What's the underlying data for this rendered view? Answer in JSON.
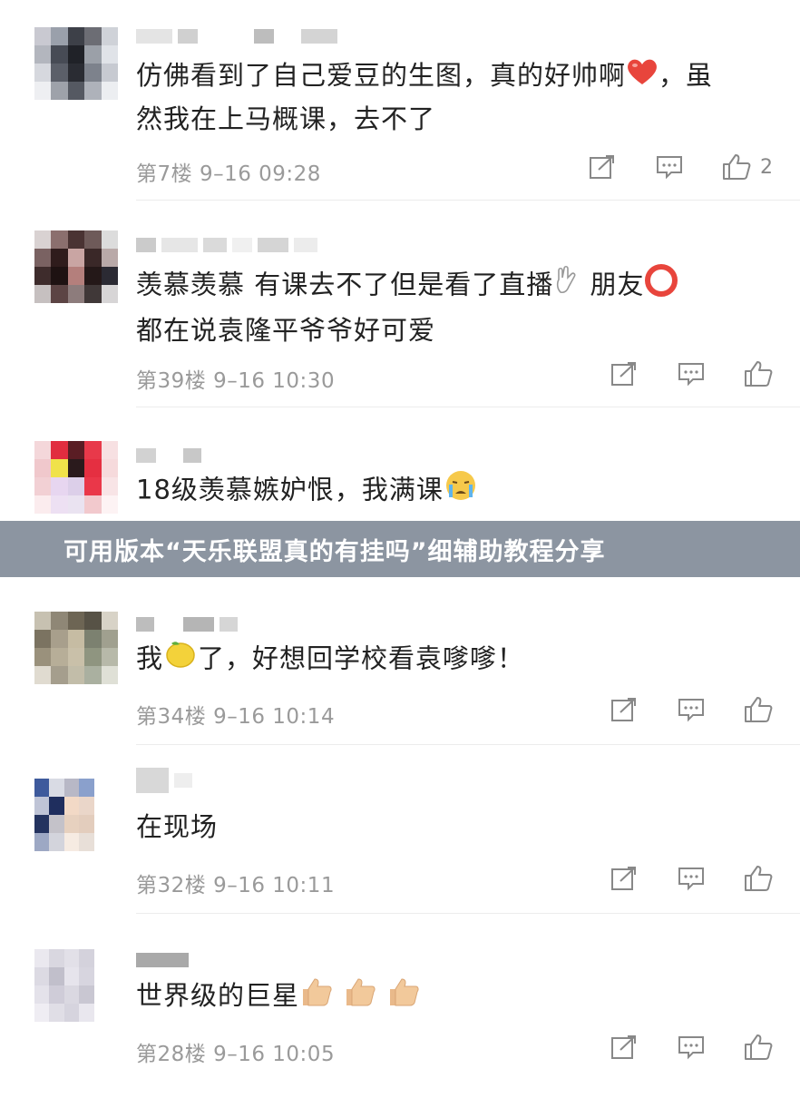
{
  "banner": {
    "title": "可用版本“天乐联盟真的有挂吗”细辅助教程分享"
  },
  "comments": [
    {
      "text_1": "仿佛看到了自己爱豆的生图，真的好帅啊",
      "text_2": "，虽",
      "text_3": "然我在上马概课，去不了",
      "meta": "第7楼 9–16 09:28",
      "likes": "2"
    },
    {
      "text_1": "羡慕羡慕 有课去不了但是看了直播",
      "text_2": " 朋友",
      "text_3": "都在说袁隆平爷爷好可爱",
      "meta": "第39楼 9–16 10:30"
    },
    {
      "text_1": "18级羡慕嫉妒恨，我满课"
    },
    {
      "text_1": "我",
      "text_2": "了，好想回学校看袁嗲嗲！",
      "meta": "第34楼 9–16 10:14"
    },
    {
      "text_1": "在现场",
      "meta": "第32楼 9–16 10:11"
    },
    {
      "text_1": "世界级的巨星",
      "meta": "第28楼 9–16 10:05"
    }
  ],
  "icons": {
    "share": "share-icon",
    "reply": "comment-icon",
    "like": "thumbs-up-icon"
  },
  "colors": {
    "text": "#222222",
    "meta": "#9a9a9a",
    "banner": "#7a8291",
    "heart": "#e8453c"
  }
}
